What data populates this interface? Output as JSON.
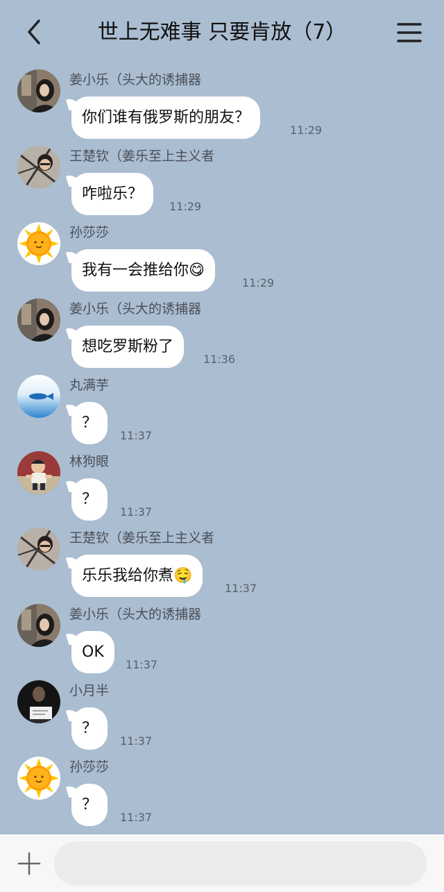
{
  "header": {
    "title": "世上无难事 只要肯放（7）",
    "back_icon": "chevron-left-icon",
    "menu_icon": "menu-icon"
  },
  "messages": [
    {
      "sender": "姜小乐（头大的诱捕器",
      "text": "你们谁有俄罗斯的朋友？",
      "time": "11:29",
      "avatar": "photo-girl"
    },
    {
      "sender": "王楚钦（姜乐至上主义者",
      "text": "咋啦乐？",
      "time": "11:29",
      "avatar": "photo-boy"
    },
    {
      "sender": "孙莎莎",
      "text": "我有一会推给你😋",
      "time": "11:29",
      "avatar": "sun"
    },
    {
      "sender": "姜小乐（头大的诱捕器",
      "text": "想吃罗斯粉了",
      "time": "11:36",
      "avatar": "photo-girl"
    },
    {
      "sender": "丸满芋",
      "text": "？",
      "time": "11:37",
      "avatar": "fish"
    },
    {
      "sender": "林狗眼",
      "text": "？",
      "time": "11:37",
      "avatar": "photo-baby"
    },
    {
      "sender": "王楚钦（姜乐至上主义者",
      "text": "乐乐我给你煮🤤",
      "time": "11:37",
      "avatar": "photo-boy"
    },
    {
      "sender": "姜小乐（头大的诱捕器",
      "text": "OK",
      "time": "11:37",
      "avatar": "photo-girl"
    },
    {
      "sender": "小月半",
      "text": "？",
      "time": "11:37",
      "avatar": "photo-dark"
    },
    {
      "sender": "孙莎莎",
      "text": "？",
      "time": "11:37",
      "avatar": "sun"
    }
  ],
  "input_bar": {
    "plus_icon": "plus-icon",
    "placeholder": ""
  },
  "colors": {
    "chat_background": "#aabdd1",
    "bubble": "#ffffff",
    "input_bar": "#f7f7f7",
    "input_field": "#ebebeb"
  }
}
